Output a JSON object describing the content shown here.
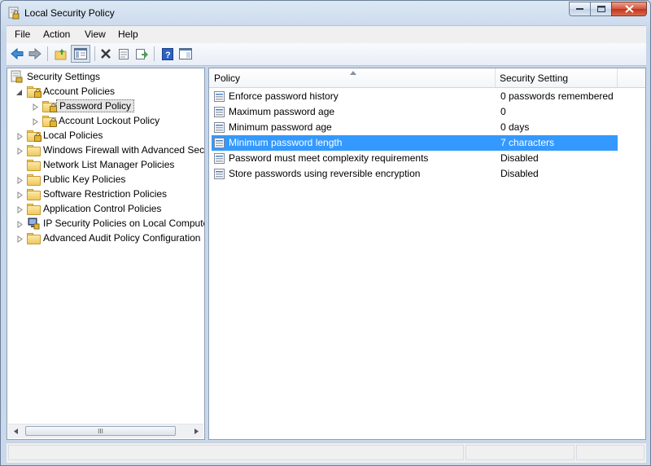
{
  "window": {
    "title": "Local Security Policy"
  },
  "menu": [
    "File",
    "Action",
    "View",
    "Help"
  ],
  "toolbar": {
    "icons": [
      "back-arrow-icon",
      "forward-arrow-icon",
      "up-folder-icon",
      "show-hide-tree-icon",
      "delete-icon",
      "properties-icon",
      "export-list-icon",
      "help-icon",
      "console-icon"
    ]
  },
  "tree": {
    "root": "Security Settings",
    "items": [
      {
        "label": "Account Policies",
        "level": 1,
        "expanded": true,
        "locked": true
      },
      {
        "label": "Password Policy",
        "level": 2,
        "selected": true,
        "locked": true
      },
      {
        "label": "Account Lockout Policy",
        "level": 2,
        "locked": true
      },
      {
        "label": "Local Policies",
        "level": 1,
        "locked": true
      },
      {
        "label": "Windows Firewall with Advanced Secu",
        "level": 1
      },
      {
        "label": "Network List Manager Policies",
        "level": 1
      },
      {
        "label": "Public Key Policies",
        "level": 1
      },
      {
        "label": "Software Restriction Policies",
        "level": 1
      },
      {
        "label": "Application Control Policies",
        "level": 1
      },
      {
        "label": "IP Security Policies on Local Compute",
        "level": 1
      },
      {
        "label": "Advanced Audit Policy Configuration",
        "level": 1
      }
    ],
    "scroll_thumb_glyph": "III"
  },
  "list": {
    "columns": [
      "Policy",
      "Security Setting"
    ],
    "rows": [
      {
        "policy": "Enforce password history",
        "setting": "0 passwords remembered"
      },
      {
        "policy": "Maximum password age",
        "setting": "0"
      },
      {
        "policy": "Minimum password age",
        "setting": "0 days"
      },
      {
        "policy": "Minimum password length",
        "setting": "7 characters",
        "selected": true
      },
      {
        "policy": "Password must meet complexity requirements",
        "setting": "Disabled"
      },
      {
        "policy": "Store passwords using reversible encryption",
        "setting": "Disabled"
      }
    ]
  },
  "colors": {
    "selection": "#3399ff",
    "frame": "#c9d8ea"
  }
}
